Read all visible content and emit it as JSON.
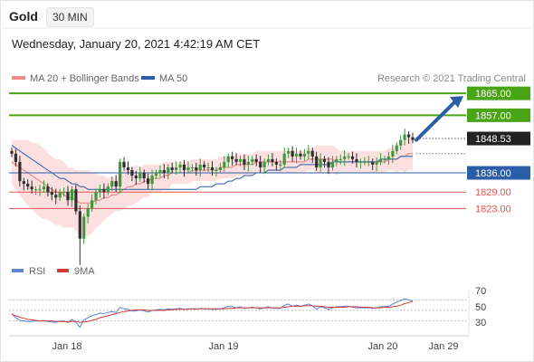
{
  "header": {
    "instrument": "Gold",
    "timeframe": "30 MIN",
    "datetime": "Wednesday, January 20, 2021 4:42:19 AM CET"
  },
  "legend": {
    "ma20": "MA 20 + Bollinger Bands",
    "ma50": "MA 50",
    "rsi": "RSI",
    "ma9": "9MA"
  },
  "watermark": "Research © 2021 Trading Central",
  "colors": {
    "green": "#4aa516",
    "red": "#e05555",
    "blue": "#2c5ea8",
    "dark": "#222222",
    "candle_up": "#3c9a3c",
    "candle_down": "#2f2f2f",
    "band_fill": "#fbd5d5",
    "rsi_line": "#5b84d6",
    "ma9_line": "#d13b3b"
  },
  "x_labels": [
    "Jan 18",
    "Jan 19",
    "Jan 20",
    "Jan 29"
  ],
  "rsi_ticks": [
    "70",
    "50",
    "30"
  ],
  "chart_data": {
    "type": "candlestick",
    "ylim": [
      1803,
      1870
    ],
    "levels": [
      {
        "value": 1865.0,
        "label": "1865.00",
        "kind": "resistance",
        "color": "#4aa516",
        "boxed": true
      },
      {
        "value": 1857.0,
        "label": "1857.00",
        "kind": "resistance",
        "color": "#4aa516",
        "boxed": true
      },
      {
        "value": 1848.53,
        "label": "1848.53",
        "kind": "last",
        "color": "#222222",
        "boxed": true
      },
      {
        "value": 1836.0,
        "label": "1836.00",
        "kind": "pivot",
        "color": "#2c5ea8",
        "boxed": true
      },
      {
        "value": 1829.0,
        "label": "1829.00",
        "kind": "support",
        "color": "#e05555",
        "boxed": false
      },
      {
        "value": 1823.0,
        "label": "1823.00",
        "kind": "support",
        "color": "#e05555",
        "boxed": false
      }
    ],
    "arrow": {
      "from": 1848,
      "to": 1864
    },
    "closes": [
      1843,
      1840,
      1833,
      1832,
      1831,
      1830,
      1830,
      1830,
      1831,
      1829,
      1828,
      1827,
      1829,
      1829,
      1826,
      1830,
      1822,
      1812,
      1820,
      1823,
      1826,
      1829,
      1830,
      1829,
      1831,
      1833,
      1831,
      1840,
      1838,
      1837,
      1835,
      1834,
      1836,
      1834,
      1832,
      1835,
      1836,
      1837,
      1836,
      1838,
      1837,
      1838,
      1839,
      1837,
      1838,
      1838,
      1837,
      1839,
      1838,
      1838,
      1837,
      1837,
      1838,
      1840,
      1842,
      1841,
      1840,
      1841,
      1839,
      1840,
      1841,
      1840,
      1838,
      1840,
      1841,
      1840,
      1839,
      1839,
      1843,
      1844,
      1842,
      1843,
      1842,
      1843,
      1844,
      1842,
      1838,
      1841,
      1840,
      1838,
      1840,
      1841,
      1841,
      1842,
      1842,
      1841,
      1840,
      1840,
      1840,
      1840,
      1839,
      1840,
      1841,
      1841,
      1842,
      1844,
      1846,
      1848,
      1850,
      1849,
      1848
    ],
    "rsi": [
      44,
      36,
      31,
      30,
      29,
      29,
      30,
      30,
      31,
      29,
      28,
      27,
      30,
      30,
      27,
      33,
      27,
      18,
      32,
      36,
      40,
      42,
      45,
      44,
      46,
      48,
      46,
      56,
      53,
      52,
      49,
      49,
      51,
      49,
      47,
      50,
      51,
      52,
      51,
      53,
      52,
      53,
      54,
      52,
      53,
      53,
      52,
      54,
      53,
      53,
      52,
      52,
      53,
      55,
      58,
      57,
      55,
      57,
      54,
      55,
      56,
      55,
      53,
      55,
      57,
      55,
      54,
      54,
      60,
      62,
      58,
      60,
      58,
      60,
      62,
      59,
      52,
      57,
      55,
      52,
      55,
      57,
      57,
      58,
      58,
      56,
      55,
      55,
      55,
      55,
      54,
      55,
      57,
      57,
      58,
      62,
      66,
      69,
      72,
      70,
      68
    ],
    "ma9": [
      42,
      40,
      37,
      35,
      33,
      32,
      31,
      30,
      30,
      30,
      30,
      29,
      29,
      29,
      28,
      29,
      29,
      27,
      28,
      29,
      31,
      33,
      36,
      38,
      40,
      42,
      44,
      46,
      48,
      49,
      50,
      51,
      51,
      51,
      50,
      50,
      50,
      50,
      50,
      51,
      51,
      52,
      52,
      52,
      52,
      53,
      53,
      53,
      53,
      53,
      53,
      53,
      53,
      53,
      54,
      54,
      55,
      55,
      55,
      55,
      55,
      55,
      55,
      55,
      55,
      55,
      55,
      55,
      56,
      57,
      58,
      58,
      58,
      59,
      59,
      59,
      58,
      58,
      57,
      56,
      56,
      56,
      56,
      56,
      57,
      57,
      57,
      56,
      56,
      56,
      55,
      55,
      55,
      56,
      56,
      57,
      58,
      60,
      63,
      65,
      67
    ],
    "ma20": [
      1840,
      1839,
      1838,
      1837,
      1836,
      1835,
      1834,
      1833,
      1832,
      1831,
      1830,
      1829,
      1829,
      1828,
      1827,
      1827,
      1826,
      1825,
      1825,
      1825,
      1825,
      1826,
      1826,
      1827,
      1827,
      1828,
      1828,
      1829,
      1830,
      1831,
      1831,
      1832,
      1832,
      1833,
      1833,
      1834,
      1834,
      1834,
      1835,
      1835,
      1836,
      1836,
      1836,
      1836,
      1836,
      1837,
      1837,
      1837,
      1837,
      1837,
      1837,
      1837,
      1838,
      1838,
      1838,
      1838,
      1839,
      1839,
      1839,
      1839,
      1839,
      1840,
      1840,
      1840,
      1840,
      1840,
      1840,
      1840,
      1840,
      1840,
      1840,
      1840,
      1840,
      1840,
      1841,
      1841,
      1841,
      1841,
      1841,
      1841,
      1841,
      1840,
      1840,
      1840,
      1840,
      1840,
      1840,
      1840,
      1840,
      1840,
      1840,
      1840,
      1840,
      1840,
      1841,
      1841,
      1841,
      1842,
      1842,
      1843,
      1843
    ],
    "ma50": [
      1846,
      1845,
      1844,
      1843,
      1842,
      1841,
      1840,
      1839,
      1838,
      1837,
      1836,
      1835,
      1834,
      1834,
      1833,
      1832,
      1832,
      1831,
      1831,
      1830,
      1830,
      1830,
      1830,
      1830,
      1830,
      1830,
      1830,
      1830,
      1830,
      1830,
      1830,
      1830,
      1830,
      1830,
      1830,
      1830,
      1830,
      1830,
      1830,
      1830,
      1830,
      1830,
      1830,
      1830,
      1830,
      1830,
      1830,
      1831,
      1831,
      1831,
      1831,
      1832,
      1832,
      1832,
      1833,
      1833,
      1834,
      1834,
      1835,
      1835,
      1835,
      1836,
      1836,
      1836,
      1837,
      1837,
      1837,
      1837,
      1838,
      1838,
      1838,
      1838,
      1839,
      1839,
      1839,
      1839,
      1839,
      1839,
      1839,
      1839,
      1840,
      1840,
      1840,
      1840,
      1840,
      1840,
      1840,
      1840,
      1840,
      1840,
      1840,
      1840,
      1841,
      1841,
      1841,
      1841,
      1841,
      1842,
      1842,
      1842,
      1842
    ],
    "band_width": [
      8,
      9,
      10,
      11,
      12,
      12,
      13,
      13,
      13,
      12,
      12,
      12,
      12,
      12,
      11,
      11,
      11,
      12,
      12,
      12,
      11,
      10,
      9,
      8,
      7,
      7,
      6,
      7,
      7,
      7,
      7,
      7,
      6,
      6,
      6,
      5,
      5,
      5,
      5,
      5,
      4,
      4,
      4,
      4,
      4,
      4,
      4,
      4,
      4,
      4,
      4,
      4,
      4,
      4,
      4,
      4,
      4,
      4,
      4,
      4,
      4,
      4,
      4,
      4,
      4,
      4,
      4,
      4,
      4,
      4,
      4,
      4,
      4,
      4,
      4,
      4,
      5,
      5,
      5,
      5,
      5,
      5,
      4,
      4,
      4,
      4,
      4,
      4,
      4,
      4,
      4,
      4,
      4,
      4,
      4,
      4,
      5,
      5,
      6,
      6,
      6
    ],
    "rsi_ylim": [
      0,
      100
    ]
  }
}
